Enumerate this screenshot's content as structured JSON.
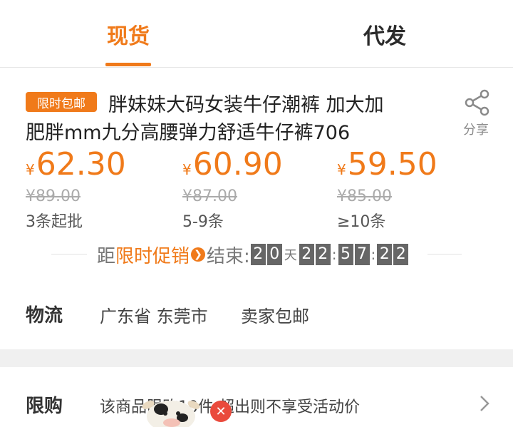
{
  "tabs": [
    {
      "label": "现货",
      "active": true
    },
    {
      "label": "代发",
      "active": false
    }
  ],
  "product": {
    "badge": "限时包邮",
    "title_line1": "胖妹妹大码女装牛仔潮裤 加大加",
    "title_line2": "肥胖mm九分高腰弹力舒适牛仔裤706"
  },
  "share": {
    "label": "分享",
    "icon": "share-icon"
  },
  "prices": [
    {
      "currency": "¥",
      "price": "62.30",
      "original": "¥89.00",
      "quantity": "3条起批"
    },
    {
      "currency": "¥",
      "price": "60.90",
      "original": "¥87.00",
      "quantity": "5-9条"
    },
    {
      "currency": "¥",
      "price": "59.50",
      "original": "¥85.00",
      "quantity": "≥10条"
    }
  ],
  "promo": {
    "prefix": "距",
    "highlight": "限时促销",
    "suffix": "结束:",
    "days": [
      "2",
      "0"
    ],
    "day_unit": "天",
    "hours": [
      "2",
      "2"
    ],
    "minutes": [
      "5",
      "7"
    ],
    "seconds": [
      "2",
      "2"
    ],
    "separator": ":"
  },
  "logistics": {
    "label": "物流",
    "location": "广东省 东莞市",
    "shipping": "卖家包邮"
  },
  "limit": {
    "label": "限购",
    "text": "该商品限购10件,超出则不享受活动价"
  },
  "colors": {
    "accent": "#f07a1a",
    "close_badge": "#ea4a3c",
    "timer_bg": "#666666"
  }
}
